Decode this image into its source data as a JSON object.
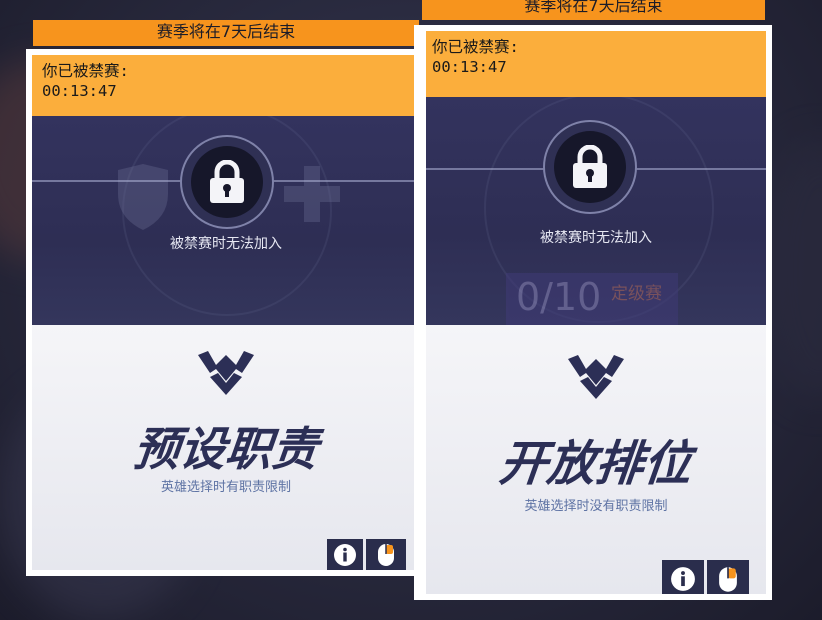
{
  "season": {
    "banner": "赛季将在7天后结束"
  },
  "ban": {
    "header_line1": "你已被禁赛:",
    "timer": "00:13:47",
    "note": "被禁赛时无法加入"
  },
  "cards": [
    {
      "mode_title": "预设职责",
      "mode_subtitle": "英雄选择时有职责限制"
    },
    {
      "mode_title": "开放排位",
      "mode_subtitle": "英雄选择时没有职责限制",
      "placement_progress": "0/10",
      "placement_label": "定级赛"
    }
  ],
  "buttons": {
    "info": "i-icon",
    "mouse": "mouse-icon"
  },
  "colors": {
    "orange": "#f7941d",
    "ban_header": "#fbae3c",
    "panel_dark": "#2e2e54",
    "title_navy": "#2c2f56"
  }
}
